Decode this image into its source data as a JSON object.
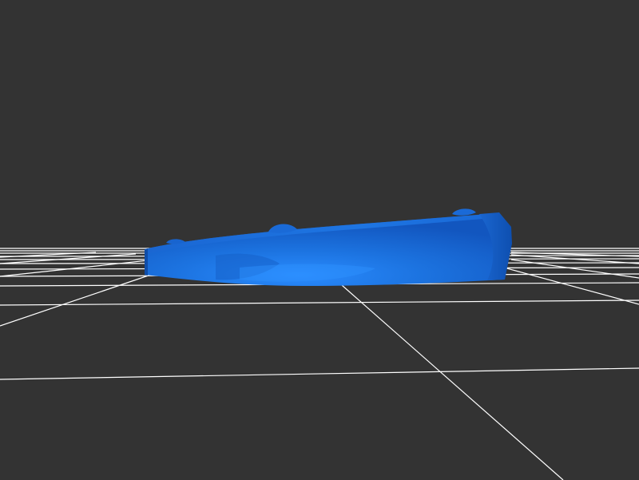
{
  "viewer": {
    "background_color": "#333333",
    "grid_color": "#ffffff",
    "model_color": "#1a6fd6",
    "model_highlight_color": "#2e8fff",
    "model_shadow_color": "#0f4fae"
  }
}
